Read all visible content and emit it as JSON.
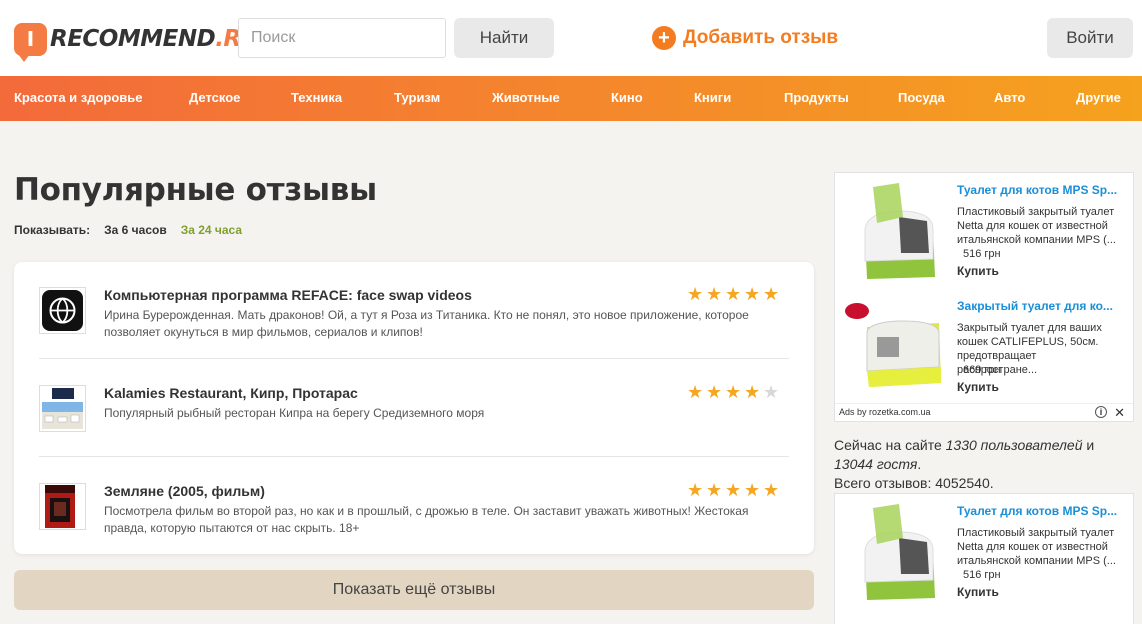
{
  "header": {
    "logo_text": "RECOMMEND",
    "logo_suffix": ".RU",
    "logo_mark": "I",
    "search_placeholder": "Поиск",
    "find_label": "Найти",
    "add_review_label": "Добавить отзыв",
    "login_label": "Войти"
  },
  "nav": {
    "items": [
      "Красота и здоровье",
      "Детское",
      "Техника",
      "Туризм",
      "Животные",
      "Кино",
      "Книги",
      "Продукты",
      "Посуда",
      "Авто",
      "Другие"
    ]
  },
  "main": {
    "title": "Популярные отзывы",
    "show_label": "Показывать:",
    "filter_6h": "За 6 часов",
    "filter_24h": "За 24 часа",
    "reviews": [
      {
        "title": "Компьютерная программа REFACE: face swap videos",
        "text": "Ирина Бурерожденная. Мать драконов! Ой, а тут я Роза из Титаника. Кто не понял, это новое приложение, которое позволяет окунуться в мир фильмов, сериалов и клипов!",
        "rating": 5
      },
      {
        "title": "Kalamies Restaurant, Кипр, Протарас",
        "text": "Популярный рыбный ресторан Кипра на берегу Средиземного моря",
        "rating": 4
      },
      {
        "title": "Земляне (2005, фильм)",
        "text": "Посмотрела фильм во второй раз, но как и в прошлый, с дрожью в теле. Он заставит уважать животных! Жестокая правда, которую пытаются от нас скрыть. 18+",
        "rating": 5
      }
    ],
    "more_label": "Показать ещё отзывы"
  },
  "sidebar": {
    "ads_top": [
      {
        "title": "Туалет для котов MPS Sp...",
        "desc": "Пластиковый закрытый туалет Netta для кошек от известной итальянской компании MPS (...",
        "price": "516 грн",
        "buy": "Купить"
      },
      {
        "title": "Закрытый туалет для ко...",
        "desc": "Закрытый туалет для ваших кошек CATLIFEPLUS, 50cм. предотвращает распростране...",
        "price": "669 грн",
        "buy": "Купить"
      }
    ],
    "ads_by": "Ads by rozetka.com.ua",
    "stats_1": "Сейчас на сайте ",
    "stats_users": "1330 пользователей",
    "stats_and": " и ",
    "stats_guests": "13044 гостя",
    "stats_dot": ".",
    "stats_total": "Всего отзывов: 4052540.",
    "ads_bottom": [
      {
        "title": "Туалет для котов MPS Sp...",
        "desc": "Пластиковый закрытый туалет Netta для кошек от известной итальянской компании MPS (...",
        "price": "516 грн",
        "buy": "Купить"
      }
    ]
  },
  "colors": {
    "accent": "#f47c20",
    "nav_start": "#f36a3b",
    "nav_end": "#f5a21e",
    "star": "#f5a623",
    "link_ad": "#1a8fd6",
    "filter_active": "#7fa02e"
  }
}
